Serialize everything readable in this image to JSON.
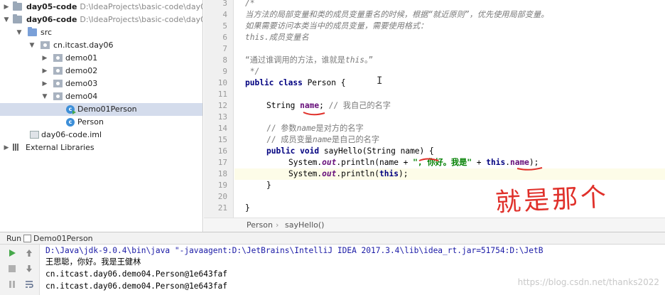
{
  "tree": {
    "items": [
      {
        "label": "day05-code",
        "path": "D:\\IdeaProjects\\basic-code\\day05-cc",
        "bold": true
      },
      {
        "label": "day06-code",
        "path": "D:\\IdeaProjects\\basic-code\\day06-cc",
        "bold": true
      },
      {
        "label": "src"
      },
      {
        "label": "cn.itcast.day06"
      },
      {
        "label": "demo01"
      },
      {
        "label": "demo02"
      },
      {
        "label": "demo03"
      },
      {
        "label": "demo04"
      },
      {
        "label": "Demo01Person"
      },
      {
        "label": "Person"
      },
      {
        "label": "day06-code.iml"
      },
      {
        "label": "External Libraries"
      }
    ]
  },
  "editor": {
    "line_numbers": [
      "3",
      "4",
      "5",
      "6",
      "7",
      "8",
      "9",
      "10",
      "11",
      "12",
      "13",
      "14",
      "15",
      "16",
      "17",
      "18",
      "19",
      "20",
      "21"
    ],
    "code": {
      "l3": "/*",
      "l4": "当方法的局部变量和类的成员变量重名的时候，根据“就近原则”，优先使用局部变量。",
      "l5": "如果需要访问本类当中的成员变量，需要使用格式：",
      "l6a": "this",
      "l6b": ".成员变量名",
      "l8a": "“通过谁调用的方法，谁就是",
      "l8b": "this",
      "l8c": "。”",
      "l9": " */",
      "l10a": "public class ",
      "l10b": "Person {",
      "l12a": "String ",
      "l12b": "name",
      "l12c": "; ",
      "l12d": "// 我自己的名字",
      "l14a": "// 参数",
      "l14b": "name",
      "l14c": "是对方的名字",
      "l15a": "// 成员变量",
      "l15b": "name",
      "l15c": "是自己的名字",
      "l16a": "public void ",
      "l16b": "sayHello(String name) {",
      "l17a": "System.",
      "l17b": "out",
      "l17c": ".println(name + ",
      "l17d": "\", 你好。我是\"",
      "l17e": " + ",
      "l17f": "this",
      "l17g": ".",
      "l17h": "name",
      "l17i": ");",
      "l18a": "System.",
      "l18b": "out",
      "l18c": ".println(",
      "l18d": "this",
      "l18e": ");",
      "l19": "}",
      "l21": "}"
    },
    "breadcrumb": [
      "Person",
      "sayHello()"
    ],
    "annotation": "就是那个"
  },
  "run": {
    "tab_prefix": "Run",
    "tab_label": "Demo01Person",
    "output": [
      "D:\\Java\\jdk-9.0.4\\bin\\java \"-javaagent:D:\\JetBrains\\IntelliJ IDEA 2017.3.4\\lib\\idea_rt.jar=51754:D:\\JetB",
      "王思聪，你好。我是王健林",
      "cn.itcast.day06.demo04.Person@1e643faf",
      "cn.itcast.day06.demo04.Person@1e643faf"
    ]
  },
  "watermark": "https://blog.csdn.net/thanks2022",
  "colors": {
    "keyword": "#000080",
    "string": "#008000",
    "field": "#660e7a",
    "comment": "#7a7a7a",
    "annotation_red": "#e0302a"
  }
}
